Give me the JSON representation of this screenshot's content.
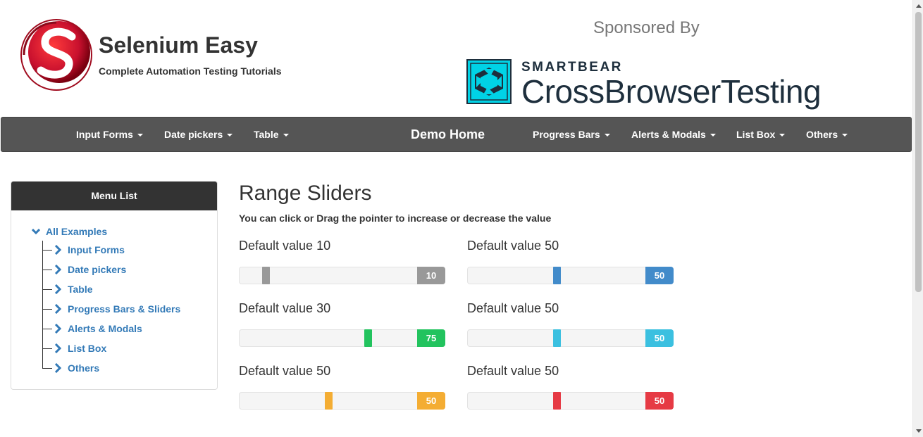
{
  "header": {
    "brand_title": "Selenium Easy",
    "brand_subtitle": "Complete Automation Testing Tutorials",
    "logo_icon": "selenium-easy-logo",
    "sponsor_label": "Sponsored By",
    "sponsor_small": "SMARTBEAR",
    "sponsor_big": "CrossBrowserTesting"
  },
  "navbar": {
    "items": [
      {
        "label": "Input Forms",
        "dropdown": true
      },
      {
        "label": "Date pickers",
        "dropdown": true
      },
      {
        "label": "Table",
        "dropdown": true
      },
      {
        "label": "Demo Home",
        "dropdown": false
      },
      {
        "label": "Progress Bars",
        "dropdown": true
      },
      {
        "label": "Alerts & Modals",
        "dropdown": true
      },
      {
        "label": "List Box",
        "dropdown": true
      },
      {
        "label": "Others",
        "dropdown": true
      }
    ]
  },
  "sidebar": {
    "title": "Menu List",
    "root": "All Examples",
    "items": [
      {
        "label": "Input Forms"
      },
      {
        "label": "Date pickers"
      },
      {
        "label": "Table"
      },
      {
        "label": "Progress Bars & Sliders"
      },
      {
        "label": "Alerts & Modals"
      },
      {
        "label": "List Box"
      },
      {
        "label": "Others"
      }
    ]
  },
  "main": {
    "title": "Range Sliders",
    "description": "You can click or Drag the pointer to increase or decrease the value",
    "sliders": [
      {
        "label": "Default value 10",
        "value": 10,
        "thumb_fraction": 0.1,
        "color": "#999999"
      },
      {
        "label": "Default value 50",
        "value": 50,
        "thumb_fraction": 0.5,
        "color": "#428bca"
      },
      {
        "label": "Default value 30",
        "value": 75,
        "thumb_fraction": 0.75,
        "color": "#22c35e"
      },
      {
        "label": "Default value 50",
        "value": 50,
        "thumb_fraction": 0.5,
        "color": "#3bc0e0"
      },
      {
        "label": "Default value 50",
        "value": 50,
        "thumb_fraction": 0.5,
        "color": "#f4ad33"
      },
      {
        "label": "Default value 50",
        "value": 50,
        "thumb_fraction": 0.5,
        "color": "#e63a44"
      }
    ]
  },
  "colors": {
    "navbar_bg": "#555555",
    "link": "#337ab7",
    "sidebar_header_bg": "#333333",
    "brand_red": "#c8102e",
    "sponsor_teal": "#00d3e6",
    "sponsor_navy": "#1e2f3d"
  }
}
